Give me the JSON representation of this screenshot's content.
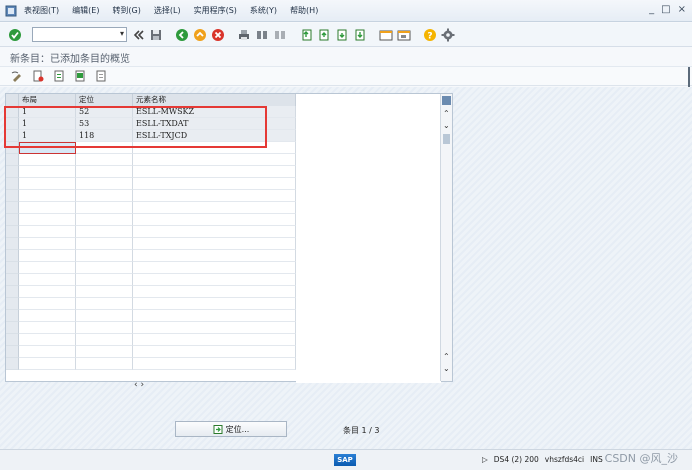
{
  "menu": {
    "items": [
      "表视图(T)",
      "编辑(E)",
      "转到(G)",
      "选择(L)",
      "实用程序(S)",
      "系统(Y)",
      "帮助(H)"
    ],
    "window_buttons": [
      "_",
      "□",
      "×"
    ]
  },
  "toolbar": {
    "command_field_value": "",
    "icons": [
      "check-icon",
      "back-double-icon",
      "save-icon",
      "back-icon",
      "exit-icon",
      "cancel-icon",
      "print-icon",
      "find-icon",
      "find-next-icon",
      "first-page-icon",
      "prev-page-icon",
      "next-page-icon",
      "last-page-icon",
      "new-session-icon",
      "shortcut-icon",
      "help-icon",
      "settings-icon"
    ]
  },
  "title": "新条目：已添加条目的概览",
  "app_toolbar": {
    "icons": [
      "change-icon",
      "delete-icon",
      "select-all-icon",
      "select-block-icon",
      "deselect-icon"
    ]
  },
  "table": {
    "columns": [
      "布局",
      "定位",
      "元素名称"
    ],
    "rows": [
      [
        "1",
        "52",
        "ESLL-MWSKZ"
      ],
      [
        "1",
        "53",
        "ESLL-TXDAT"
      ],
      [
        "1",
        "118",
        "ESLL-TXJCD"
      ]
    ],
    "empty_rows": 19
  },
  "scroll": {
    "h": "‹ ›",
    "up": "⌃",
    "down": "⌄"
  },
  "bottom": {
    "position_button": "定位...",
    "entry_count": "条目 1 / 3"
  },
  "status": {
    "logo": "SAP",
    "play": "▷",
    "system": "DS4 (2) 200",
    "server": "vhszfds4ci",
    "mode": "INS",
    "watermark": "CSDN @风_沙"
  },
  "colors": {
    "highlight_box": "#e53935",
    "accent": "#1e6fbf"
  }
}
